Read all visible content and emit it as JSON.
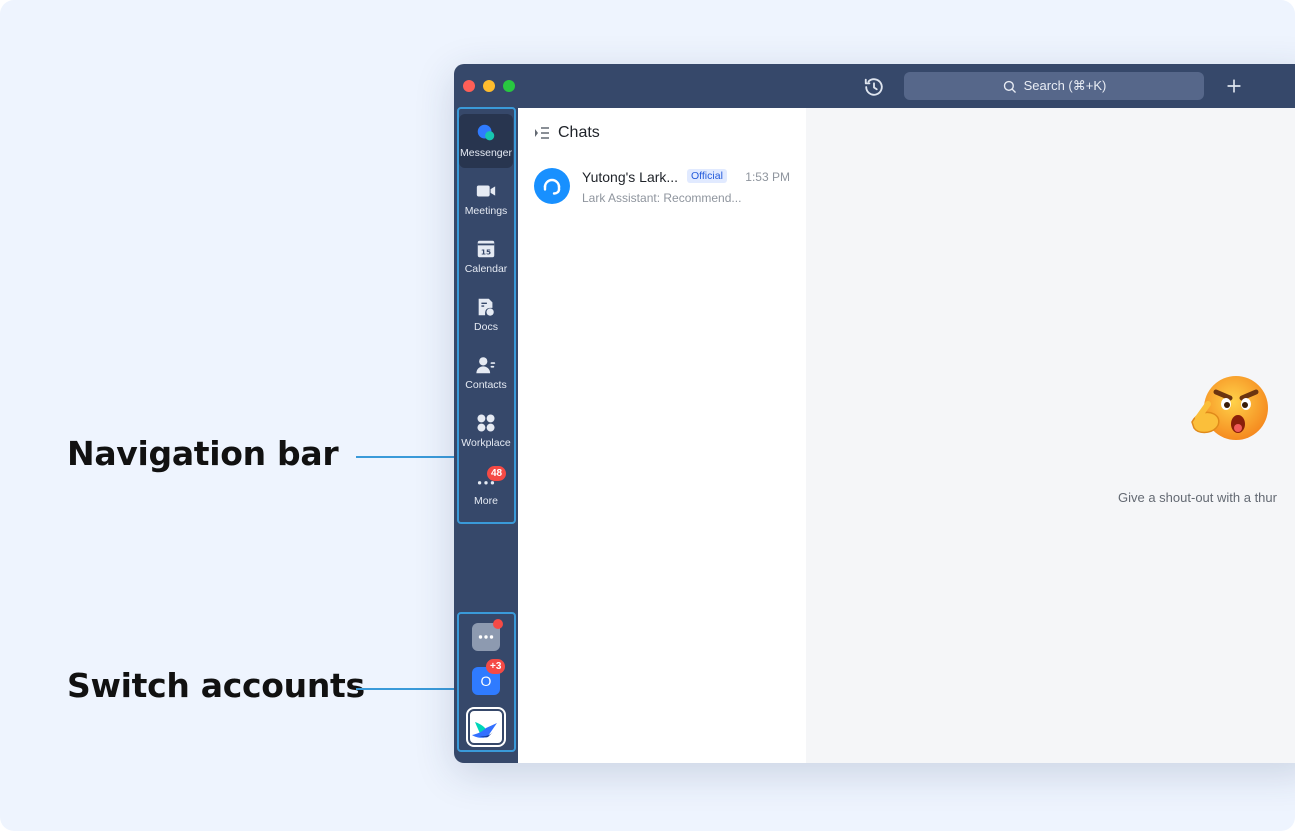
{
  "annotations": {
    "navigation_bar": "Navigation bar",
    "switch_accounts": "Switch accounts"
  },
  "titlebar": {
    "search_placeholder": "Search (⌘+K)",
    "history_icon": "history-icon",
    "add_icon": "plus-icon"
  },
  "nav": {
    "items": [
      {
        "label": "Messenger",
        "icon": "messenger-icon",
        "active": true
      },
      {
        "label": "Meetings",
        "icon": "video-camera-icon"
      },
      {
        "label": "Calendar",
        "icon": "calendar-icon",
        "icon_text": "15"
      },
      {
        "label": "Docs",
        "icon": "docs-icon"
      },
      {
        "label": "Contacts",
        "icon": "contacts-icon"
      },
      {
        "label": "Workplace",
        "icon": "workplace-icon"
      },
      {
        "label": "More",
        "icon": "more-icon",
        "badge": "48"
      }
    ]
  },
  "accounts": {
    "items": [
      {
        "icon": "more-accounts-icon",
        "dot": true
      },
      {
        "letter": "O",
        "badge": "+3"
      },
      {
        "icon": "lark-logo-icon"
      }
    ]
  },
  "chatlist": {
    "title": "Chats",
    "chats": [
      {
        "name": "Yutong's Lark...",
        "tag": "Official",
        "time": "1:53 PM",
        "preview": "Lark Assistant: Recommend..."
      }
    ]
  },
  "main": {
    "empty_text": "Give a shout-out with a thur"
  },
  "colors": {
    "navbar": "#36486a",
    "accent": "#3a9ad9",
    "badge": "#f54a45",
    "avatar": "#1890ff"
  }
}
